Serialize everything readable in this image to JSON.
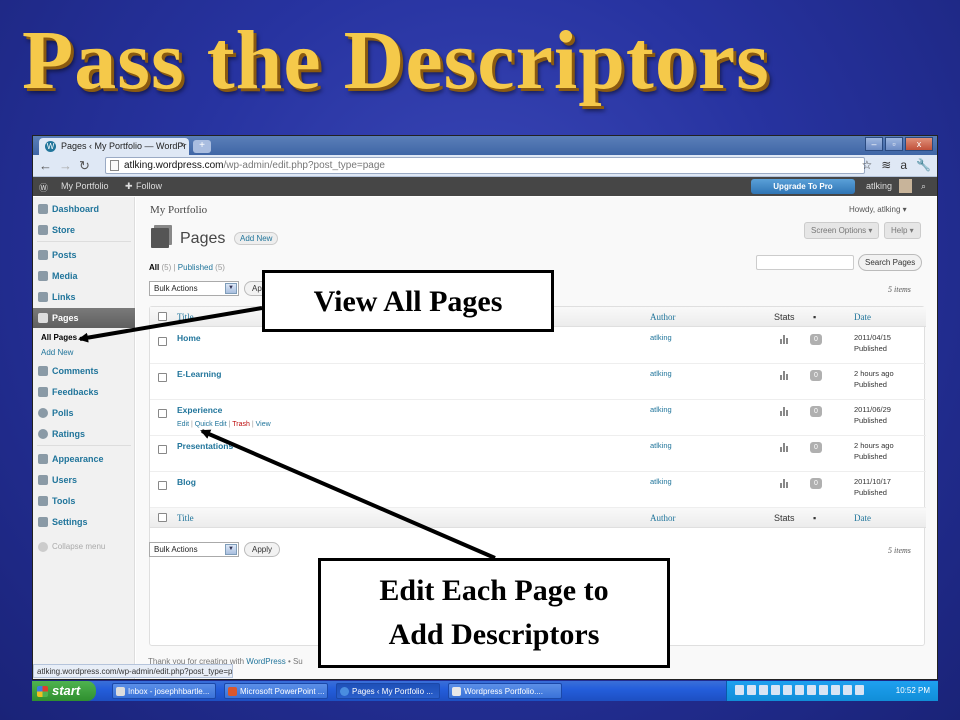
{
  "slide": {
    "title": "Pass the Descriptors"
  },
  "browser": {
    "tab_title": "Pages ‹ My Portfolio — WordPr",
    "url_host": "atlking.wordpress.com",
    "url_path": "/wp-admin/edit.php?post_type=page",
    "window_controls": [
      "–",
      "▫",
      "x"
    ]
  },
  "adminbar": {
    "site": "My Portfolio",
    "follow": "Follow",
    "upgrade": "Upgrade To Pro",
    "user": "atlking"
  },
  "sidebar": {
    "items": [
      {
        "label": "Dashboard"
      },
      {
        "label": "Store"
      },
      {
        "label": "Posts"
      },
      {
        "label": "Media"
      },
      {
        "label": "Links"
      },
      {
        "label": "Pages"
      },
      {
        "label": "Comments"
      },
      {
        "label": "Feedbacks"
      },
      {
        "label": "Polls"
      },
      {
        "label": "Ratings"
      },
      {
        "label": "Appearance"
      },
      {
        "label": "Users"
      },
      {
        "label": "Tools"
      },
      {
        "label": "Settings"
      }
    ],
    "sub_all_pages": "All Pages",
    "sub_add_new": "Add New",
    "collapse": "Collapse menu"
  },
  "content": {
    "site_title": "My Portfolio",
    "howdy": "Howdy, atlking ▾",
    "heading": "Pages",
    "add_new": "Add New",
    "screen_options": "Screen Options ▾",
    "help": "Help ▾",
    "filter_all": "All",
    "filter_all_count": "(5)",
    "filter_published": "Published",
    "filter_published_count": "(5)",
    "search_button": "Search Pages",
    "bulk_actions": "Bulk Actions",
    "apply": "Apply",
    "items_count": "5 items",
    "columns": {
      "title": "Title",
      "author": "Author",
      "stats": "Stats",
      "date": "Date"
    },
    "rows": [
      {
        "title": "Home",
        "author": "atlking",
        "comments": "0",
        "date": "2011/04/15",
        "status": "Published"
      },
      {
        "title": "E-Learning",
        "author": "atlking",
        "comments": "0",
        "date": "2 hours ago",
        "status": "Published"
      },
      {
        "title": "Experience",
        "author": "atlking",
        "comments": "0",
        "date": "2011/06/29",
        "status": "Published"
      },
      {
        "title": "Presentations",
        "author": "atlking",
        "comments": "0",
        "date": "2 hours ago",
        "status": "Published"
      },
      {
        "title": "Blog",
        "author": "atlking",
        "comments": "0",
        "date": "2011/10/17",
        "status": "Published"
      }
    ],
    "row_actions": {
      "edit": "Edit",
      "quick_edit": "Quick Edit",
      "trash": "Trash",
      "view": "View"
    },
    "footer_text": "Thank you for creating with",
    "footer_link": "WordPress",
    "footer_tail": "• Su",
    "status_url": "atlking.wordpress.com/wp-admin/edit.php?post_type=page"
  },
  "taskbar": {
    "start": "start",
    "tasks": [
      {
        "label": "Inbox - josephhbartle..."
      },
      {
        "label": "Microsoft PowerPoint ..."
      },
      {
        "label": "Pages ‹ My Portfolio ..."
      },
      {
        "label": "Wordpress Portfolio...."
      }
    ],
    "clock": "10:52 PM"
  },
  "callouts": {
    "view_all": "View All Pages",
    "edit_line1": "Edit Each Page to",
    "edit_line2": "Add Descriptors"
  },
  "colors": {
    "title_gold": "#f5c94a",
    "wp_link": "#21759b",
    "trash_red": "#bc0b0b"
  }
}
